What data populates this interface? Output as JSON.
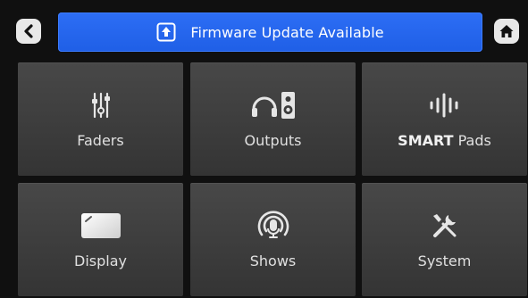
{
  "header": {
    "back_icon": "chevron-left-icon",
    "home_icon": "home-icon",
    "banner": {
      "icon": "upload-icon",
      "text": "Firmware Update Available",
      "color": "#2766ee"
    }
  },
  "tiles": [
    {
      "id": "faders",
      "icon": "faders-icon",
      "label": "Faders"
    },
    {
      "id": "outputs",
      "icon": "headphones-speaker-icon",
      "label": "Outputs"
    },
    {
      "id": "smart-pads",
      "icon": "waveform-icon",
      "label_bold": "SMART",
      "label": " Pads"
    },
    {
      "id": "display",
      "icon": "display-icon",
      "label": "Display"
    },
    {
      "id": "shows",
      "icon": "podcast-mic-icon",
      "label": "Shows"
    },
    {
      "id": "system",
      "icon": "tools-icon",
      "label": "System"
    }
  ]
}
